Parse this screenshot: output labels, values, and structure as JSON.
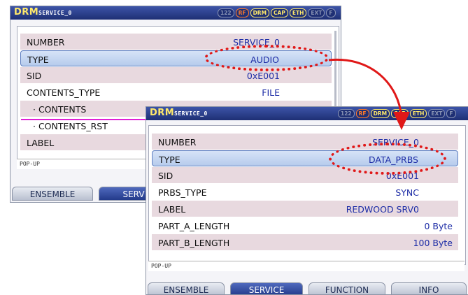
{
  "window1": {
    "brand": "DRM",
    "title": "SERVICE_0",
    "badges": [
      "122",
      "RF",
      "DRM",
      "CAP",
      "ETH",
      "EXT",
      "F"
    ],
    "rows": [
      {
        "label": "NUMBER",
        "value": "SERVICE_0"
      },
      {
        "label": "TYPE",
        "value": "AUDIO"
      },
      {
        "label": "SID",
        "value": "0xE001"
      },
      {
        "label": "CONTENTS_TYPE",
        "value": "FILE"
      },
      {
        "label": "· CONTENTS",
        "value": ""
      },
      {
        "label": "· CONTENTS_RST",
        "value": ""
      },
      {
        "label": "LABEL",
        "value": ""
      }
    ],
    "popup": "POP-UP",
    "tabs": [
      "ENSEMBLE",
      "SERV"
    ]
  },
  "window2": {
    "brand": "DRM",
    "title": "SERVICE_0",
    "badges": [
      "122",
      "RF",
      "DRM",
      "CAP",
      "ETH",
      "EXT",
      "F"
    ],
    "rows": [
      {
        "label": "NUMBER",
        "value": "SERVICE_0"
      },
      {
        "label": "TYPE",
        "value": "DATA_PRBS"
      },
      {
        "label": "SID",
        "value": "0xE001"
      },
      {
        "label": "PRBS_TYPE",
        "value": "SYNC"
      },
      {
        "label": "LABEL",
        "value": "REDWOOD SRV0"
      },
      {
        "label": "PART_A_LENGTH",
        "value": "0 Byte"
      },
      {
        "label": "PART_B_LENGTH",
        "value": "100 Byte"
      }
    ],
    "popup": "POP-UP",
    "tabs": [
      "ENSEMBLE",
      "SERVICE",
      "FUNCTION",
      "INFO"
    ]
  },
  "colors": {
    "titlebar": "#1e2f74",
    "value_text": "#1d2ca6",
    "annotation": "#e01818",
    "highlight_line": "#e01fd6"
  }
}
